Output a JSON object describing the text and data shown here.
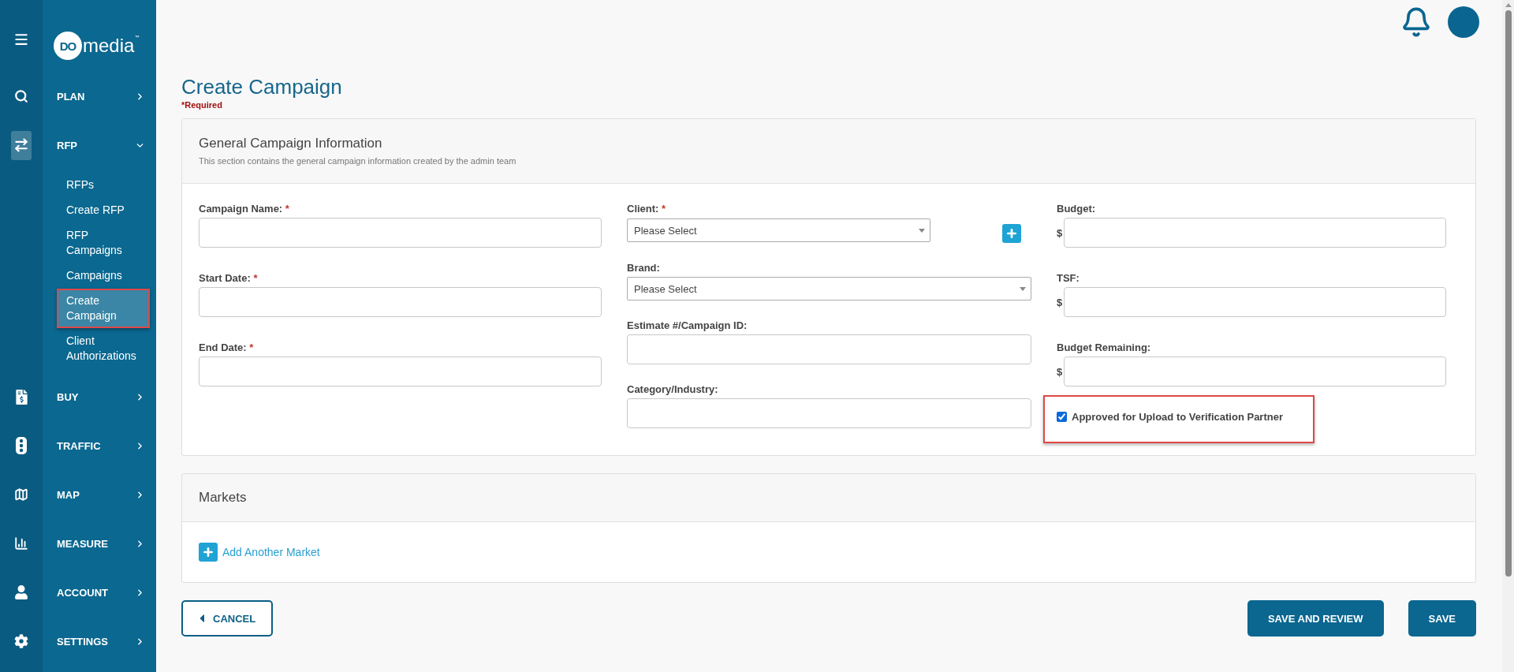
{
  "sidebar": {
    "logo": {
      "badge": "DO",
      "text": "media",
      "sup": "™"
    },
    "nav": [
      {
        "label": "PLAN",
        "selected": false,
        "expanded": false
      },
      {
        "label": "RFP",
        "selected": true,
        "expanded": true,
        "children": [
          {
            "label": "RFPs",
            "selected": false,
            "highlighted": false
          },
          {
            "label": "Create RFP",
            "selected": false,
            "highlighted": false
          },
          {
            "label": "RFP Campaigns",
            "selected": false,
            "highlighted": false
          },
          {
            "label": "Campaigns",
            "selected": false,
            "highlighted": false
          },
          {
            "label": "Create Campaign",
            "selected": true,
            "highlighted": true
          },
          {
            "label": "Client Authorizations",
            "selected": false,
            "highlighted": false
          }
        ]
      },
      {
        "label": "BUY",
        "selected": false,
        "expanded": false
      },
      {
        "label": "TRAFFIC",
        "selected": false,
        "expanded": false
      },
      {
        "label": "MAP",
        "selected": false,
        "expanded": false
      },
      {
        "label": "MEASURE",
        "selected": false,
        "expanded": false
      },
      {
        "label": "ACCOUNT",
        "selected": false,
        "expanded": false
      },
      {
        "label": "SETTINGS",
        "selected": false,
        "expanded": false
      }
    ]
  },
  "page": {
    "title": "Create Campaign",
    "required_note": "*Required"
  },
  "general": {
    "title": "General Campaign Information",
    "subtitle": "This section contains the general campaign information created by the admin team",
    "columns": [
      [
        {
          "kind": "text",
          "label": "Campaign Name:",
          "required_mark": "*"
        },
        {
          "kind": "text",
          "label": "Start Date:",
          "required_mark": "*"
        },
        {
          "kind": "text",
          "label": "End Date:",
          "required_mark": "*"
        }
      ],
      [
        {
          "kind": "select",
          "label": "Client:",
          "required_mark": "*",
          "value": "Please Select",
          "add_button": true
        },
        {
          "kind": "select",
          "label": "Brand:",
          "value": "Please Select",
          "add_button": false
        },
        {
          "kind": "text",
          "label": "Estimate #/Campaign ID:"
        },
        {
          "kind": "text",
          "label": "Category/Industry:"
        }
      ],
      [
        {
          "kind": "currency",
          "label": "Budget:",
          "prefix": "$"
        },
        {
          "kind": "currency",
          "label": "TSF:",
          "prefix": "$"
        },
        {
          "kind": "currency",
          "label": "Budget Remaining:",
          "prefix": "$"
        },
        {
          "kind": "checkbox",
          "label": "Approved for Upload to Verification Partner",
          "checked": true,
          "highlighted": true
        }
      ]
    ]
  },
  "markets": {
    "title": "Markets",
    "add_link": "Add Another Market"
  },
  "actions": [
    {
      "kind": "back",
      "label": "CANCEL"
    },
    {
      "kind": "primary",
      "label": "SAVE AND REVIEW"
    },
    {
      "kind": "primary",
      "label": "SAVE"
    }
  ]
}
